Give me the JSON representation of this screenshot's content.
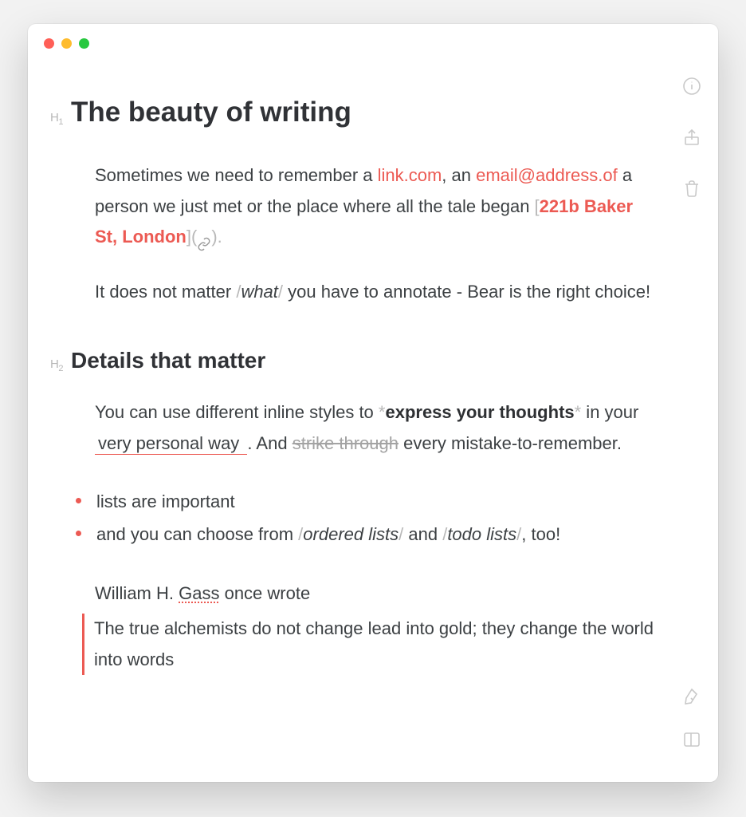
{
  "title_marker": "H",
  "title_marker_num": "1",
  "title": "The beauty of writing",
  "p1_a": "Sometimes we need to remember a ",
  "p1_link": "link.com",
  "p1_b": ", an ",
  "p1_email": "email@address.of",
  "p1_c": " a person we just met or the place where all the tale began ",
  "p1_open": "[",
  "p1_addr": "221b Baker St, London",
  "p1_mid": "](",
  "p1_close": ").",
  "p2_a": "It does not matter ",
  "p2_slash": "/",
  "p2_ital": "what",
  "p2_b": " you have to annotate - Bear is the right choice!",
  "h2_marker_num": "2",
  "h2": "Details that matter",
  "p3_a": "You can use different inline styles to ",
  "p3_ast": "*",
  "p3_bold": "express your thoughts",
  "p3_b": " in your ",
  "p3_uline": " very personal way ",
  "p3_c": ". And ",
  "p3_strike": "strike through",
  "p3_d": " every mistake-to-remember.",
  "li1": "lists are important",
  "li2_a": "and you can choose from ",
  "li2_ital1": "ordered lists",
  "li2_b": " and ",
  "li2_ital2": "todo lists",
  "li2_c": ", too!",
  "fn_a": "William H. ",
  "fn_sq": "Gass",
  "fn_b": " once wrote",
  "quote": "The true alchemists do not change lead into gold; they change the world into words"
}
